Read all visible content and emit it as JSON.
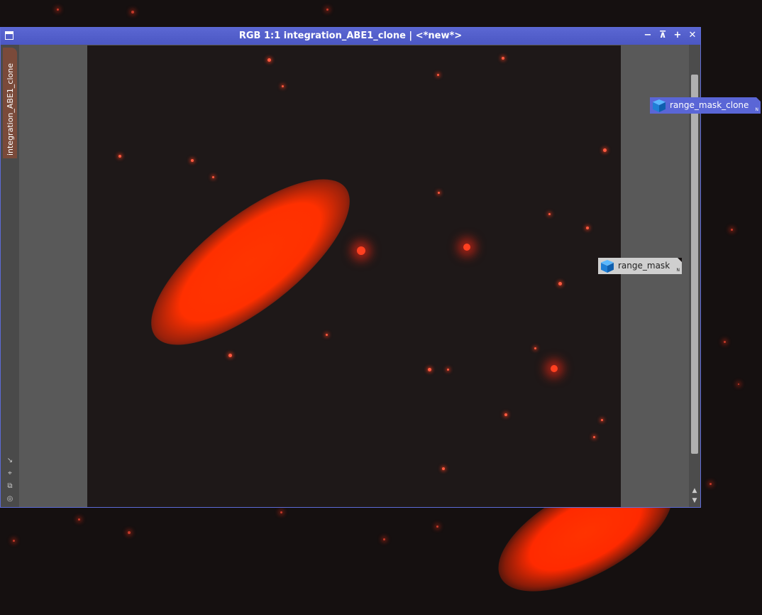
{
  "window": {
    "title": "RGB 1:1 integration_ABE1_clone | <*new*>",
    "side_tab": "integration_ABE1_clone",
    "buttons": {
      "minimize": "−",
      "shade": "⊼",
      "maximize": "+",
      "close": "✕"
    }
  },
  "left_tools": [
    "↘",
    "⌖",
    "⧉",
    "◎"
  ],
  "scroll": {
    "up": "▲",
    "down": "▼"
  },
  "masks": [
    {
      "label": "range_mask_clone",
      "badge": "N"
    },
    {
      "label": "range_mask",
      "badge": "N"
    }
  ],
  "colors": {
    "titlebar": "#5b67d3",
    "galaxy": "#ff3300",
    "mask_clone_bg": "#5a66d6",
    "mask_bg": "#cfcfcf"
  }
}
